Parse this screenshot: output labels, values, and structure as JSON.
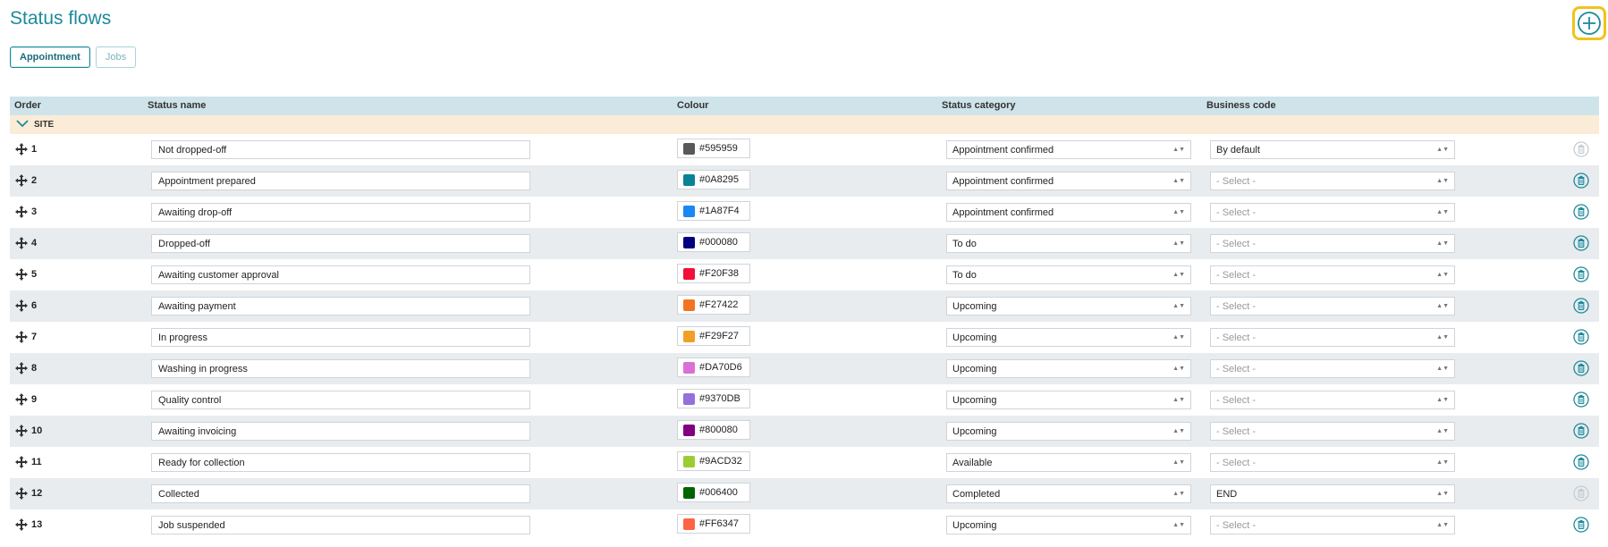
{
  "page": {
    "title": "Status flows",
    "add_icon": "plus-circle-icon",
    "accent_color": "#1c8a9b",
    "highlight_color": "#f0c419"
  },
  "tabs": [
    {
      "label": "Appointment",
      "active": true
    },
    {
      "label": "Jobs",
      "active": false
    }
  ],
  "table": {
    "columns": {
      "order": "Order",
      "status_name": "Status name",
      "colour": "Colour",
      "status_category": "Status category",
      "business_code": "Business code"
    },
    "group": "SITE",
    "rows": [
      {
        "order": "1",
        "name": "Not dropped-off",
        "colour": "#595959",
        "category": "Appointment confirmed",
        "business_code": "By default",
        "delete_enabled": false
      },
      {
        "order": "2",
        "name": "Appointment prepared",
        "colour": "#0A8295",
        "category": "Appointment confirmed",
        "business_code": "- Select -",
        "delete_enabled": true
      },
      {
        "order": "3",
        "name": "Awaiting drop-off",
        "colour": "#1A87F4",
        "category": "Appointment confirmed",
        "business_code": "- Select -",
        "delete_enabled": true
      },
      {
        "order": "4",
        "name": "Dropped-off",
        "colour": "#000080",
        "category": "To do",
        "business_code": "- Select -",
        "delete_enabled": true
      },
      {
        "order": "5",
        "name": "Awaiting customer approval",
        "colour": "#F20F38",
        "category": "To do",
        "business_code": "- Select -",
        "delete_enabled": true
      },
      {
        "order": "6",
        "name": "Awaiting payment",
        "colour": "#F27422",
        "category": "Upcoming",
        "business_code": "- Select -",
        "delete_enabled": true
      },
      {
        "order": "7",
        "name": "In progress",
        "colour": "#F29F27",
        "category": "Upcoming",
        "business_code": "- Select -",
        "delete_enabled": true
      },
      {
        "order": "8",
        "name": "Washing in progress",
        "colour": "#DA70D6",
        "category": "Upcoming",
        "business_code": "- Select -",
        "delete_enabled": true
      },
      {
        "order": "9",
        "name": "Quality control",
        "colour": "#9370DB",
        "category": "Upcoming",
        "business_code": "- Select -",
        "delete_enabled": true
      },
      {
        "order": "10",
        "name": "Awaiting invoicing",
        "colour": "#800080",
        "category": "Upcoming",
        "business_code": "- Select -",
        "delete_enabled": true
      },
      {
        "order": "11",
        "name": "Ready for collection",
        "colour": "#9ACD32",
        "category": "Available",
        "business_code": "- Select -",
        "delete_enabled": true
      },
      {
        "order": "12",
        "name": "Collected",
        "colour": "#006400",
        "category": "Completed",
        "business_code": "END",
        "delete_enabled": false
      },
      {
        "order": "13",
        "name": "Job suspended",
        "colour": "#FF6347",
        "category": "Upcoming",
        "business_code": "- Select -",
        "delete_enabled": true
      }
    ]
  }
}
